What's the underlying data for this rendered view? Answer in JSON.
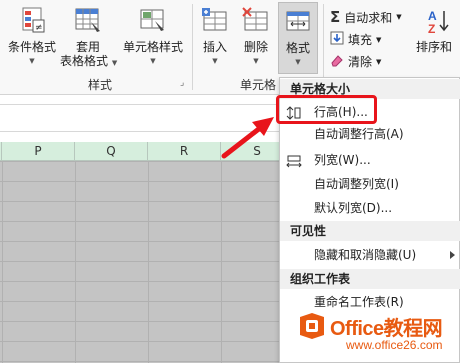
{
  "ribbon": {
    "buttons": {
      "conditional_format": "条件格式",
      "table_format_line1": "套用",
      "table_format_line2": "表格格式",
      "cell_styles": "单元格样式",
      "insert": "插入",
      "delete": "删除",
      "format": "格式",
      "sort_filter": "排序和"
    },
    "small": {
      "autosum": "自动求和",
      "fill": "填充",
      "clear": "清除"
    },
    "groups": {
      "styles": "样式",
      "cells": "单元格"
    }
  },
  "sheet": {
    "columns": [
      "P",
      "Q",
      "R",
      "S"
    ]
  },
  "menu": {
    "sections": {
      "cell_size": "单元格大小",
      "visibility": "可见性",
      "organize": "组织工作表"
    },
    "items": {
      "row_height": "行高(H)...",
      "autofit_row": "自动调整行高(A)",
      "col_width": "列宽(W)...",
      "autofit_col": "自动调整列宽(I)",
      "default_width": "默认列宽(D)...",
      "hide_unhide": "隐藏和取消隐藏(U)",
      "rename": "重命名工作表(R)"
    }
  },
  "watermark": {
    "brand": "Office教程网",
    "url": "www.office26.com"
  },
  "colors": {
    "highlight": "#e8141b",
    "header_bg": "#d6eedd",
    "watermark": "#e85a11"
  }
}
